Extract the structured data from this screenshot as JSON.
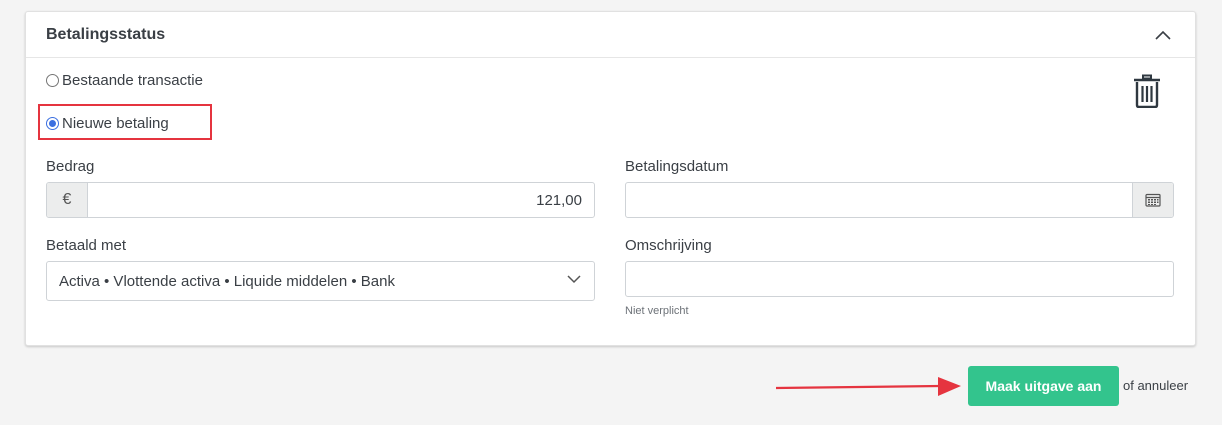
{
  "panel": {
    "title": "Betalingsstatus"
  },
  "payment_type": {
    "options": [
      {
        "label": "Bestaande transactie",
        "selected": false
      },
      {
        "label": "Nieuwe betaling",
        "selected": true
      }
    ]
  },
  "fields": {
    "amount": {
      "label": "Bedrag",
      "currency_symbol": "€",
      "value": "121,00"
    },
    "payment_date": {
      "label": "Betalingsdatum",
      "value": ""
    },
    "paid_with": {
      "label": "Betaald met",
      "value": "Activa • Vlottende activa • Liquide middelen • Bank"
    },
    "description": {
      "label": "Omschrijving",
      "value": "",
      "helper": "Niet verplicht"
    }
  },
  "actions": {
    "submit_label": "Maak uitgave aan",
    "cancel_text": "of annuleer"
  },
  "icons": {
    "collapse": "chevron-up-icon",
    "delete": "trash-icon",
    "calendar": "calendar-icon",
    "dropdown": "chevron-down-icon"
  },
  "colors": {
    "accent_green": "#33c48d",
    "highlight_red": "#e5343f",
    "radio_blue": "#3b6fe0"
  }
}
